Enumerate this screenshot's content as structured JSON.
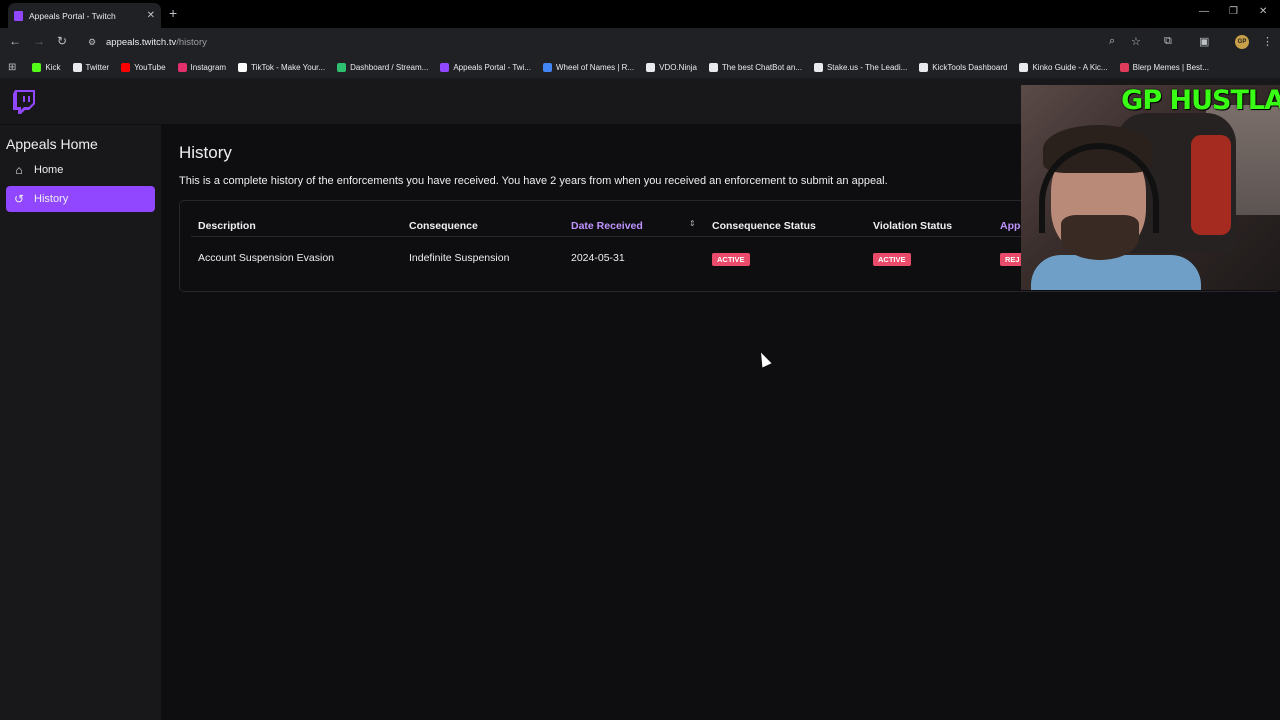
{
  "browser": {
    "tab_title": "Appeals Portal - Twitch",
    "tab_close": "✕",
    "new_tab": "+",
    "window_controls": [
      "—",
      "❐",
      "✕"
    ],
    "url_host": "appeals.twitch.tv",
    "url_path": "/history",
    "bookmarks": [
      {
        "label": "Kick",
        "color": "#53fc18"
      },
      {
        "label": "Twitter",
        "color": "#e8eaed"
      },
      {
        "label": "YouTube",
        "color": "#ff0000"
      },
      {
        "label": "Instagram",
        "color": "#e1306c"
      },
      {
        "label": "TikTok - Make Your...",
        "color": "#ffffff"
      },
      {
        "label": "Dashboard / Stream...",
        "color": "#2fbf71"
      },
      {
        "label": "Appeals Portal - Twi...",
        "color": "#9146ff"
      },
      {
        "label": "Wheel of Names | R...",
        "color": "#4285f4"
      },
      {
        "label": "VDO.Ninja",
        "color": "#e8eaed"
      },
      {
        "label": "The best ChatBot an...",
        "color": "#e8eaed"
      },
      {
        "label": "Stake.us - The Leadi...",
        "color": "#e8eaed"
      },
      {
        "label": "KickTools Dashboard",
        "color": "#e8eaed"
      },
      {
        "label": "Kinko Guide - A Kic...",
        "color": "#e8eaed"
      },
      {
        "label": "Blerp Memes | Best...",
        "color": "#e03b5a"
      }
    ],
    "profile_initials": "GP"
  },
  "sidebar": {
    "title": "Appeals Home",
    "items": [
      {
        "label": "Home",
        "icon": "home-icon"
      },
      {
        "label": "History",
        "icon": "history-icon"
      }
    ]
  },
  "main": {
    "title": "History",
    "intro": "This is a complete history of the enforcements you have received. You have 2 years from when you received an enforcement to submit an appeal.",
    "columns": [
      "Description",
      "Consequence",
      "Date Received",
      "Consequence Status",
      "Violation Status",
      "Appe"
    ],
    "rows": [
      {
        "description": "Account Suspension Evasion",
        "consequence": "Indefinite Suspension",
        "date_received": "2024-05-31",
        "consequence_status": "ACTIVE",
        "violation_status": "ACTIVE",
        "appeal_status": "REJ"
      }
    ]
  },
  "webcam": {
    "overlay_text": "GP HUSTLA"
  },
  "colors": {
    "accent": "#9146ff",
    "sorted_header": "#bf94ff",
    "badge_red": "#eb4b6a",
    "overlay_green": "#39ff14"
  }
}
